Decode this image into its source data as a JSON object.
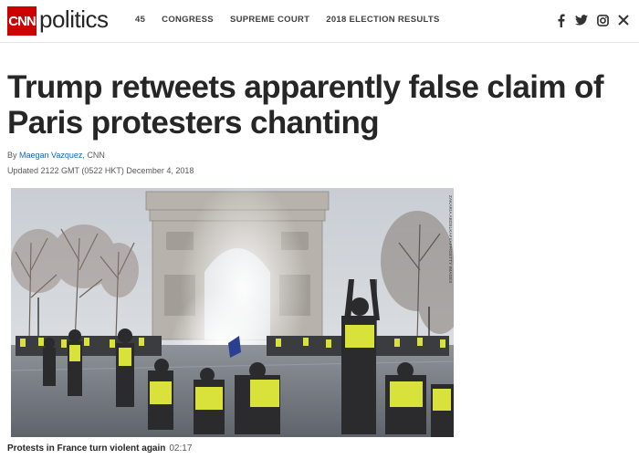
{
  "header": {
    "logo_text": "CNN",
    "section": "politics",
    "nav": [
      "45",
      "CONGRESS",
      "SUPREME COURT",
      "2018 ELECTION RESULTS"
    ],
    "social_icons": [
      "facebook-icon",
      "twitter-icon",
      "instagram-icon",
      "close-icon"
    ],
    "brand_color": "#cc0000"
  },
  "article": {
    "headline": "Trump retweets apparently false claim of Paris protesters chanting",
    "byline_prefix": "By ",
    "author": "Maegan Vazquez",
    "byline_suffix": ", CNN",
    "updated": "Updated 2122 GMT (0522 HKT) December 4, 2018"
  },
  "media": {
    "photo_credit": "ZAKARIA ABDELKAFI/AFP/GETTY IMAGES",
    "caption": "Protests in France turn violent again",
    "duration": "02:17",
    "accent_vest_color": "#d8e23a"
  }
}
